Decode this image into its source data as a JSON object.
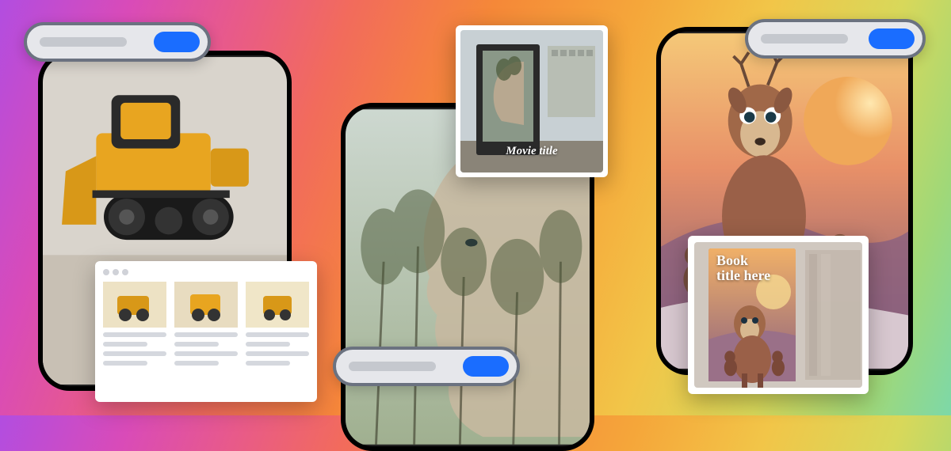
{
  "cards": {
    "left": {
      "image_alt": "toy-bulldozer"
    },
    "middle": {
      "image_alt": "forest-face-double-exposure"
    },
    "right": {
      "image_alt": "cartoon-deer-sunset"
    }
  },
  "search_pills": {
    "left": {
      "placeholder": "",
      "button": ""
    },
    "middle": {
      "placeholder": "",
      "button": ""
    },
    "right": {
      "placeholder": "",
      "button": ""
    }
  },
  "results_panel": {
    "thumbs": [
      "bulldozer-1",
      "bulldozer-2",
      "bulldozer-3"
    ]
  },
  "poster_mockup": {
    "label": "Movie title"
  },
  "book_mockup": {
    "title_line1": "Book",
    "title_line2": "title here"
  }
}
